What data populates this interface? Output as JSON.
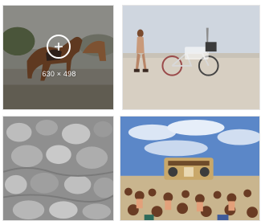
{
  "gallery": {
    "items": [
      {
        "name": "horse",
        "hovered": true,
        "dimensions": "630 × 498"
      },
      {
        "name": "desert-bicycle"
      },
      {
        "name": "mud-crowd"
      },
      {
        "name": "festival-stage"
      }
    ]
  },
  "icons": {
    "zoom": "plus-icon"
  }
}
